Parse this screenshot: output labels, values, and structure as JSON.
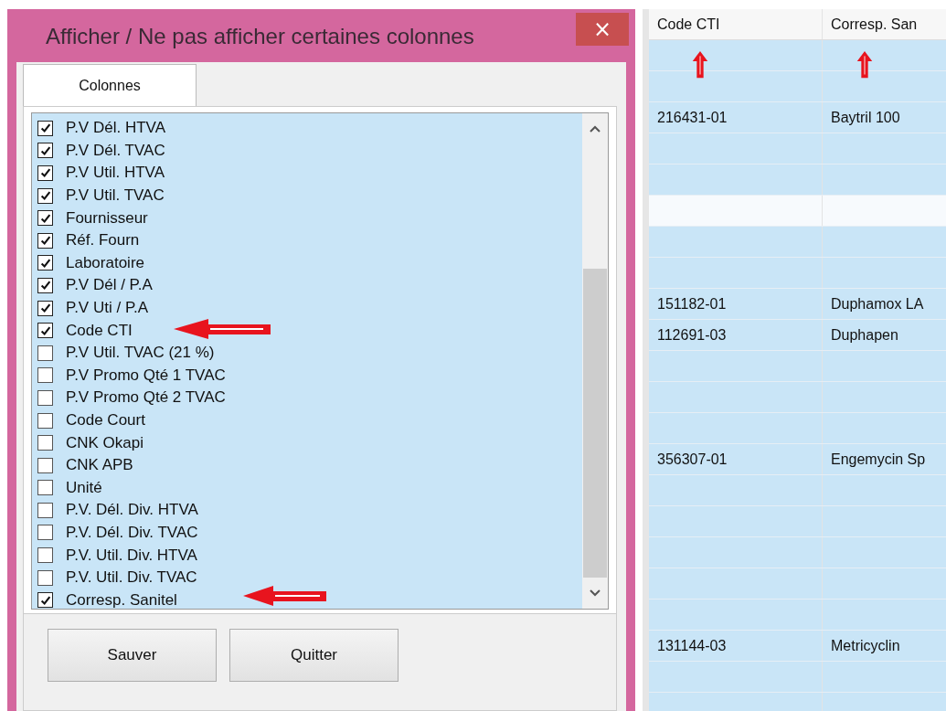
{
  "dialog": {
    "title": "Afficher / Ne pas afficher certaines colonnes",
    "close_label": "×",
    "tabs": [
      {
        "label": "Colonnes",
        "selected": true
      }
    ],
    "columns": [
      {
        "label": "P.V Dél. HTVA",
        "checked": true
      },
      {
        "label": "P.V Dél. TVAC",
        "checked": true
      },
      {
        "label": "P.V Util. HTVA",
        "checked": true
      },
      {
        "label": "P.V Util. TVAC",
        "checked": true
      },
      {
        "label": "Fournisseur",
        "checked": true
      },
      {
        "label": "Réf. Fourn",
        "checked": true
      },
      {
        "label": "Laboratoire",
        "checked": true
      },
      {
        "label": "P.V Dél / P.A",
        "checked": true
      },
      {
        "label": "P.V Uti / P.A",
        "checked": true
      },
      {
        "label": "Code CTI",
        "checked": true
      },
      {
        "label": "P.V Util. TVAC (21 %)",
        "checked": false
      },
      {
        "label": "P.V Promo Qté 1 TVAC",
        "checked": false
      },
      {
        "label": "P.V Promo Qté 2 TVAC",
        "checked": false
      },
      {
        "label": "Code Court",
        "checked": false
      },
      {
        "label": "CNK Okapi",
        "checked": false
      },
      {
        "label": "CNK APB",
        "checked": false
      },
      {
        "label": "Unité",
        "checked": false
      },
      {
        "label": "P.V. Dél. Div. HTVA",
        "checked": false
      },
      {
        "label": "P.V. Dél. Div. TVAC",
        "checked": false
      },
      {
        "label": "P.V. Util. Div. HTVA",
        "checked": false
      },
      {
        "label": "P.V. Util. Div. TVAC",
        "checked": false
      },
      {
        "label": "Corresp. Sanitel",
        "checked": true
      }
    ],
    "buttons": [
      "Sauver",
      "Quitter"
    ]
  },
  "table": {
    "columns": [
      "Code CTI",
      "Corresp. San"
    ],
    "rows": [
      {
        "selected": false
      },
      {
        "selected": false
      },
      {
        "selected": false,
        "cells": [
          "216431-01",
          "Baytril 100"
        ]
      },
      {
        "selected": false
      },
      {
        "selected": false
      },
      {
        "selected": true
      },
      {
        "selected": false
      },
      {
        "selected": false
      },
      {
        "selected": false,
        "cells": [
          "151182-01",
          "Duphamox LA"
        ]
      },
      {
        "selected": false,
        "cells": [
          "112691-03",
          "Duphapen"
        ]
      },
      {
        "selected": false
      },
      {
        "selected": false
      },
      {
        "selected": false
      },
      {
        "selected": false,
        "cells": [
          "356307-01",
          "Engemycin Sp"
        ]
      },
      {
        "selected": false
      },
      {
        "selected": false
      },
      {
        "selected": false
      },
      {
        "selected": false
      },
      {
        "selected": false
      },
      {
        "selected": false,
        "cells": [
          "131144-03",
          "Metricyclin"
        ]
      },
      {
        "selected": false
      },
      {
        "selected": false
      }
    ]
  }
}
